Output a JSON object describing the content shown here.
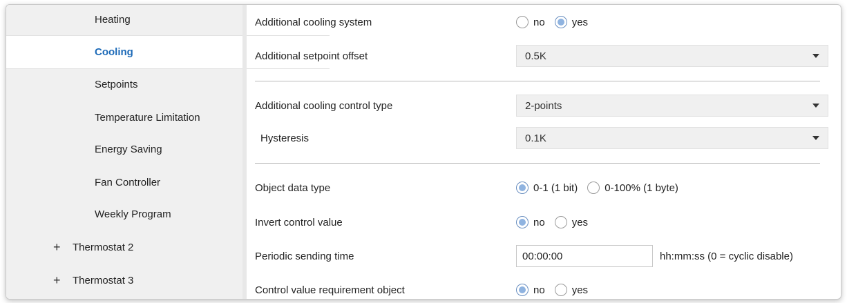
{
  "sidebar": {
    "items": [
      {
        "label": "Heating"
      },
      {
        "label": "Cooling"
      },
      {
        "label": "Setpoints"
      },
      {
        "label": "Temperature Limitation"
      },
      {
        "label": "Energy Saving"
      },
      {
        "label": "Fan Controller"
      },
      {
        "label": "Weekly Program"
      }
    ],
    "groups": [
      {
        "label": "Thermostat 2",
        "icon": "plus-icon"
      },
      {
        "label": "Thermostat 3",
        "icon": "plus-icon"
      }
    ],
    "selected": "Cooling"
  },
  "form": {
    "additional_cooling_system": {
      "label": "Additional cooling system",
      "options": [
        "no",
        "yes"
      ],
      "selected": "yes"
    },
    "additional_setpoint_offset": {
      "label": "Additional setpoint offset",
      "value": "0.5K"
    },
    "additional_cooling_control_type": {
      "label": "Additional cooling control type",
      "value": "2-points"
    },
    "hysteresis": {
      "label": "Hysteresis",
      "value": "0.1K"
    },
    "object_data_type": {
      "label": "Object data type",
      "options": [
        "0-1 (1 bit)",
        "0-100% (1 byte)"
      ],
      "selected": "0-1 (1 bit)"
    },
    "invert_control_value": {
      "label": "Invert control value",
      "options": [
        "no",
        "yes"
      ],
      "selected": "no"
    },
    "periodic_sending_time": {
      "label": "Periodic sending time",
      "value": "00:00:00",
      "suffix": "hh:mm:ss (0 = cyclic disable)"
    },
    "control_value_requirement_object": {
      "label": "Control value requirement object",
      "options": [
        "no",
        "yes"
      ],
      "selected": "no"
    }
  },
  "colors": {
    "accent": "#1e6bb8",
    "radio_fill": "#8fb3e0",
    "sidebar_bg": "#f0f0f0"
  }
}
